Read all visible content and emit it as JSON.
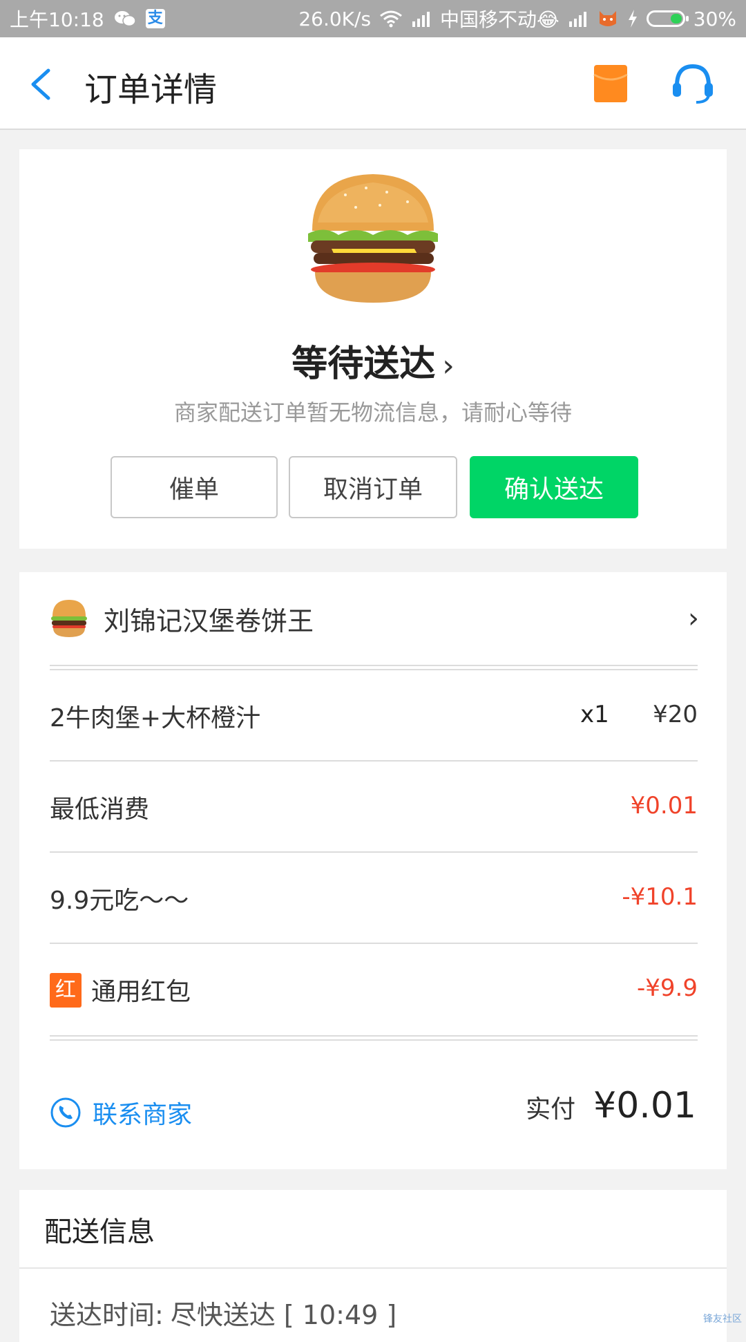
{
  "status_bar": {
    "time": "上午10:18",
    "speed": "26.0K/s",
    "carrier": "中国移不动😂",
    "battery": "30%",
    "battery_level": 0.3,
    "icons": [
      "wechat-icon",
      "alipay-icon",
      "wifi-icon",
      "signal-icon",
      "cat-icon",
      "charging-icon"
    ]
  },
  "header": {
    "title": "订单详情",
    "back_icon": "chevron-left-icon",
    "redpacket_icon": "red-packet-icon",
    "service_icon": "headset-icon",
    "accent": "#1a8ef0"
  },
  "status": {
    "image": "burger-image",
    "title": "等待送达",
    "title_chevron": "›",
    "description": "商家配送订单暂无物流信息，请耐心等待",
    "buttons": {
      "urge": "催单",
      "cancel": "取消订单",
      "confirm": "确认送达"
    },
    "confirm_color": "#00d566"
  },
  "order": {
    "shop_name": "刘锦记汉堡卷饼王",
    "shop_chevron": "›",
    "items": [
      {
        "name": "2牛肉堡+大杯橙汁",
        "qty": "x1",
        "price": "¥20"
      }
    ],
    "fees": [
      {
        "name": "最低消费",
        "amount": "¥0.01"
      },
      {
        "name": "9.9元吃～～",
        "amount": "-¥10.1"
      }
    ],
    "red_packet": {
      "badge": "红",
      "name": "通用红包",
      "amount": "-¥9.9",
      "badge_color": "#ff6a1a"
    },
    "contact_label": "联系商家",
    "paid_label": "实付",
    "paid_amount": "¥0.01",
    "discount_color": "#f0432a"
  },
  "delivery": {
    "title": "配送信息",
    "time_label": "送达时间:",
    "time_value": "尽快送达 [ 10:49 ]"
  },
  "watermark": "锋友社区"
}
